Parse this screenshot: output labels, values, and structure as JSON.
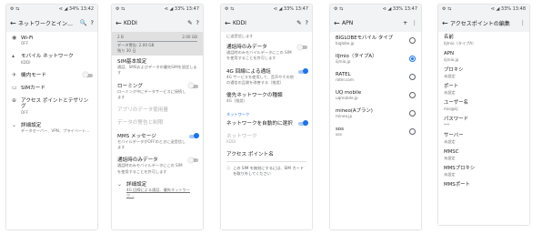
{
  "screens": [
    {
      "status": {
        "left": "⚙ ⇆",
        "right": "⊲ ◢ 34% 13:42"
      },
      "appbar": {
        "back": "←",
        "title": "ネットワークとインター…",
        "actions": [
          "🔍",
          "?"
        ]
      },
      "rows": [
        {
          "icon": "◉",
          "title": "Wi-Fi",
          "sub": "OFF"
        },
        {
          "icon": "▴",
          "title": "モバイル ネットワーク",
          "sub": "KDDI"
        },
        {
          "icon": "✈",
          "title": "機内モード",
          "sub": "",
          "toggle": "off"
        },
        {
          "icon": "▭",
          "title": "SIMカード",
          "sub": ""
        },
        {
          "icon": "⊕",
          "title": "アクセス ポイントとテザリング",
          "sub": "OFF"
        },
        {
          "icon": "⌄",
          "title": "詳細設定",
          "sub": "データセーバー、VPN、プライベート…"
        }
      ]
    },
    {
      "status": {
        "left": "⚙ ⇆",
        "right": "⊲ ◢ 33% 13:47"
      },
      "appbar": {
        "back": "←",
        "title": "KDDI",
        "actions": [
          "✎",
          "?"
        ]
      },
      "data_panel": {
        "r1l": "2 B",
        "r1r": "2.00 GB",
        "r2": "データ警告: 2.00 GB",
        "r3": "残り 30 日"
      },
      "rows": [
        {
          "title": "SIM基本設定",
          "sub": "通話、SMSおよびデータの優先SIMを設定します"
        },
        {
          "title": "ローミング",
          "sub": "ローミング中にデータサービスに接続します",
          "toggle": "off"
        },
        {
          "title": "アプリのデータ使用量",
          "sub": "",
          "dim": true
        },
        {
          "title": "データの警告と制限",
          "sub": "",
          "dim": true
        },
        {
          "title": "MMS メッセージ",
          "sub": "モバイルデータがOFFのときに送受信します",
          "toggle": "on"
        },
        {
          "title": "通話時のみデータ",
          "sub": "通話時のみモバイルデータにこの SIM を使用することを許可します",
          "toggle": "off"
        },
        {
          "title": "詳細設定",
          "sub": "4G 回線による通話、優先ネットワーク…",
          "underline": true
        }
      ]
    },
    {
      "status": {
        "left": "⚙ ⇆",
        "right": "⊲ ◢ 33% 13:47"
      },
      "appbar": {
        "back": "←",
        "title": "KDDI",
        "actions": [
          "✎",
          "?"
        ]
      },
      "top_text": "に送受信します",
      "rows": [
        {
          "title": "通話時のみデータ",
          "sub": "通話時のみモバイルデータにこの SIM を使用することを許可します",
          "toggle": "off"
        },
        {
          "title": "4G 回線による通話",
          "sub": "4G サービスを使用して、音声やその他の通信の品質を改善する（推奨）",
          "toggle": "on"
        },
        {
          "title": "優先ネットワークの種類",
          "sub": "4G（推奨）"
        }
      ],
      "section": "ネットワーク",
      "rows2": [
        {
          "title": "ネットワークを自動的に選択",
          "sub": "",
          "toggle": "on"
        },
        {
          "title": "ネットワーク",
          "sub": "KDDI",
          "dim": true
        },
        {
          "title": "アクセス ポイント名",
          "sub": ""
        }
      ],
      "info": {
        "icon": "ⓘ",
        "text": "この SIM を無効にするには、SIM カードを取り外してください"
      }
    },
    {
      "status": {
        "left": "⚙ ⇆",
        "right": "⊲ ◢ 33% 13:47"
      },
      "appbar": {
        "back": "←",
        "title": "APN",
        "actions": [
          "+",
          "⋮"
        ]
      },
      "apns": [
        {
          "name": "BIGLOBEモバイル タイプ",
          "apn": "biglobe.jp",
          "selected": false
        },
        {
          "name": "IIJmio（タイプA）",
          "apn": "iijmio.jp",
          "selected": true
        },
        {
          "name": "RATEL",
          "apn": "ratel.com",
          "selected": false
        },
        {
          "name": "UQ mobile",
          "apn": "uqmobile.jp",
          "selected": false
        },
        {
          "name": "mineo(Aプラン)",
          "apn": "mineo.jp",
          "selected": false
        },
        {
          "name": "sos",
          "apn": "sos",
          "selected": false
        }
      ]
    },
    {
      "status": {
        "left": "⚙ ⇆",
        "right": "⊲ ◢ 33% 13:48"
      },
      "appbar": {
        "back": "←",
        "title": "アクセスポイントの編集",
        "actions": [
          "⋮"
        ]
      },
      "fields": [
        {
          "label": "名前",
          "value": "IIJmio（タイプA）"
        },
        {
          "label": "APN",
          "value": "iijmio.jp"
        },
        {
          "label": "プロキシ",
          "value": "未設定"
        },
        {
          "label": "ポート",
          "value": "未設定"
        },
        {
          "label": "ユーザー名",
          "value": "mio@iij"
        },
        {
          "label": "パスワード",
          "value": "***"
        },
        {
          "label": "サーバー",
          "value": "未設定"
        },
        {
          "label": "MMSC",
          "value": "未設定"
        },
        {
          "label": "MMSプロキシ",
          "value": "未設定"
        },
        {
          "label": "MMSポート",
          "value": ""
        }
      ]
    }
  ]
}
